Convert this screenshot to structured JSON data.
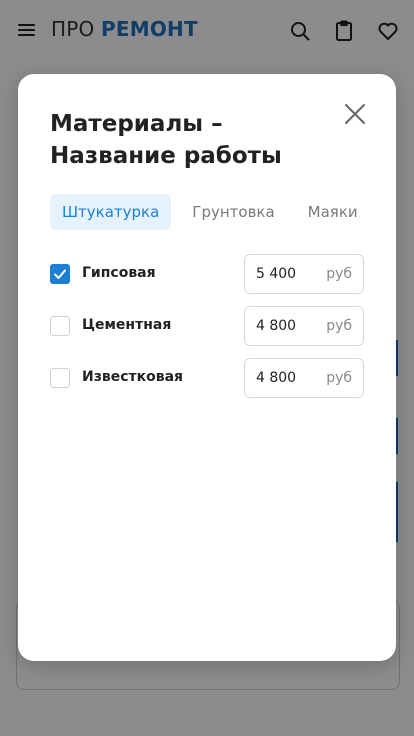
{
  "header": {
    "logo_part1": "ПРО",
    "logo_part2": "РЕМОНТ",
    "icons": [
      "menu-icon",
      "search-icon",
      "clipboard-icon",
      "heart-icon"
    ]
  },
  "modal": {
    "title": "Материалы – Название работы",
    "close_icon": "close-icon",
    "tabs": [
      {
        "label": "Штукатурка",
        "active": true
      },
      {
        "label": "Грунтовка",
        "active": false
      },
      {
        "label": "Маяки",
        "active": false
      }
    ],
    "items": [
      {
        "label": "Гипсовая",
        "checked": true,
        "price": "5 400",
        "unit": "руб"
      },
      {
        "label": "Цементная",
        "checked": false,
        "price": "4 800",
        "unit": "руб"
      },
      {
        "label": "Известковая",
        "checked": false,
        "price": "4 800",
        "unit": "руб"
      }
    ]
  },
  "colors": {
    "accent": "#1d7fd1",
    "tab_active_bg": "#e6f2fb",
    "logo_accent": "#1f6fbf",
    "overlay": "rgba(0,0,0,0.45)"
  }
}
